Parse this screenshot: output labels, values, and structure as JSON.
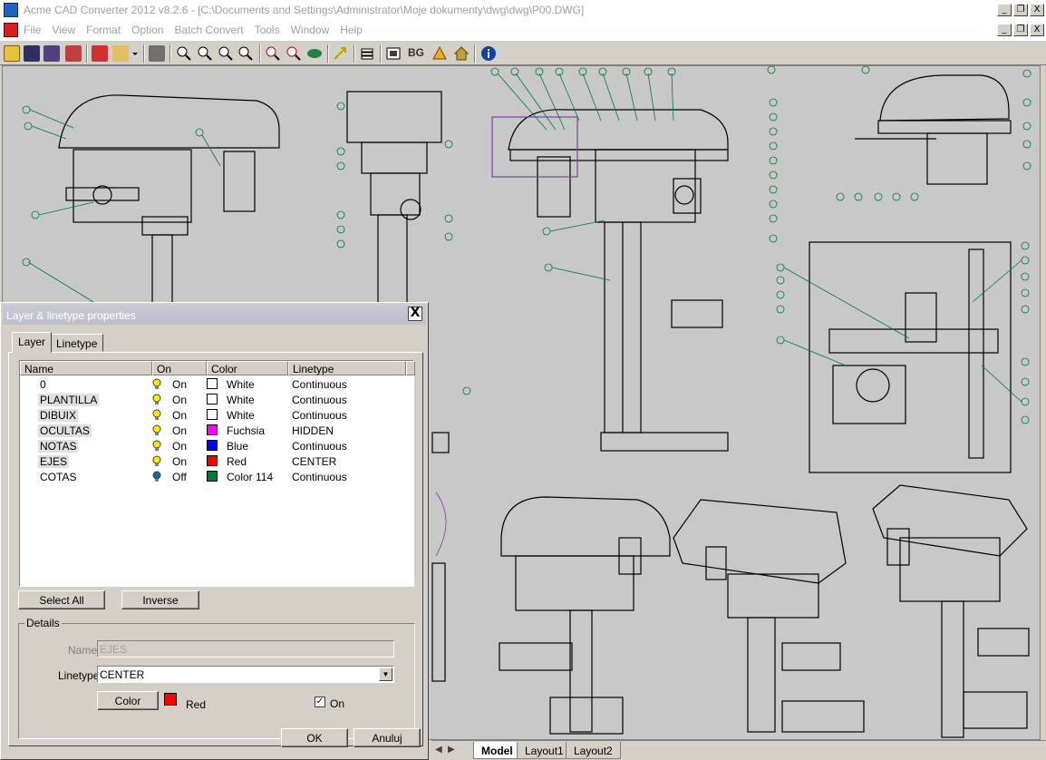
{
  "window": {
    "title": "Acme CAD Converter 2012 v8.2.6 - [C:\\Documents and Settings\\Administrator\\Moje dokumenty\\dwg\\dwg\\P00.DWG]",
    "minimize": "_",
    "restore": "❐",
    "close": "X"
  },
  "menu": [
    "File",
    "View",
    "Format",
    "Option",
    "Batch Convert",
    "Tools",
    "Window",
    "Help"
  ],
  "toolbar": {
    "bg_label": "BG"
  },
  "layout_tabs": {
    "nav": [
      "◀",
      "▶"
    ],
    "tabs": [
      "Model",
      "Layout1",
      "Layout2"
    ],
    "active": "Model"
  },
  "dialog": {
    "title": "Layer & linetype properties",
    "close": "X",
    "tabs": [
      "Layer",
      "Linetype"
    ],
    "columns": [
      "Name",
      "On",
      "Color",
      "Linetype"
    ],
    "layers": [
      {
        "name": "0",
        "on": "On",
        "color": "White",
        "swatch": "#ffffff",
        "linetype": "Continuous",
        "bulb": "#ffee00"
      },
      {
        "name": "PLANTILLA",
        "on": "On",
        "color": "White",
        "swatch": "#ffffff",
        "linetype": "Continuous",
        "bulb": "#ffee00"
      },
      {
        "name": "DIBUIX",
        "on": "On",
        "color": "White",
        "swatch": "#ffffff",
        "linetype": "Continuous",
        "bulb": "#ffee00"
      },
      {
        "name": "OCULTAS",
        "on": "On",
        "color": "Fuchsia",
        "swatch": "#ff00ff",
        "linetype": "HIDDEN",
        "bulb": "#ffee00"
      },
      {
        "name": "NOTAS",
        "on": "On",
        "color": "Blue",
        "swatch": "#0000ff",
        "linetype": "Continuous",
        "bulb": "#ffee00"
      },
      {
        "name": "EJES",
        "on": "On",
        "color": "Red",
        "swatch": "#ff0000",
        "linetype": "CENTER",
        "bulb": "#ffee00"
      },
      {
        "name": "COTAS",
        "on": "Off",
        "color": "Color 114",
        "swatch": "#007a3d",
        "linetype": "Continuous",
        "bulb": "#2060a0"
      }
    ],
    "select_all": "Select All",
    "inverse": "Inverse",
    "details": {
      "title": "Details",
      "name_label": "Name",
      "name_value": "EJES",
      "linetype_label": "Linetype",
      "linetype_value": "CENTER",
      "color_button": "Color",
      "color_swatch": "#ff0000",
      "color_name": "Red",
      "on_label": "On",
      "on_checked": "✓"
    },
    "ok": "OK",
    "cancel": "Anuluj"
  }
}
